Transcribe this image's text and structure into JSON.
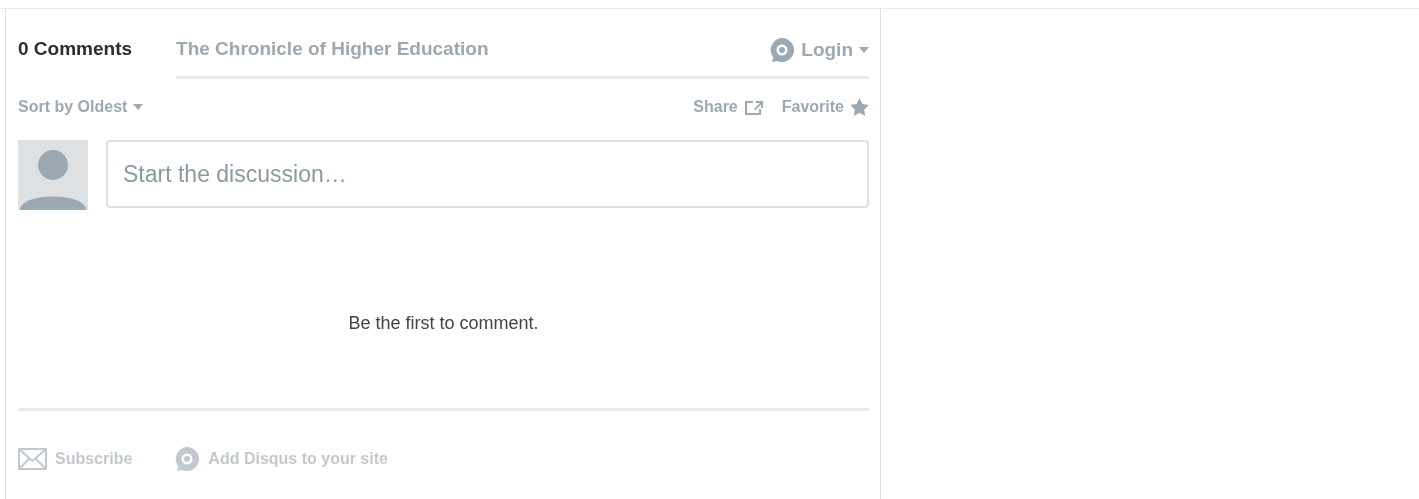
{
  "tabs": [
    {
      "label": "0 Comments",
      "selected": true
    },
    {
      "label": "The Chronicle of Higher Education",
      "selected": false
    }
  ],
  "login": {
    "label": "Login"
  },
  "sort": {
    "label": "Sort by Oldest"
  },
  "actions": [
    {
      "label": "Share",
      "kind": "share"
    },
    {
      "label": "Favorite",
      "kind": "favorite"
    }
  ],
  "composer": {
    "placeholder": "Start the discussion…"
  },
  "empty_message": "Be the first to comment.",
  "footer": [
    {
      "label": "Subscribe",
      "kind": "mail"
    },
    {
      "label": "Add Disqus to your site",
      "kind": "disqus"
    }
  ]
}
